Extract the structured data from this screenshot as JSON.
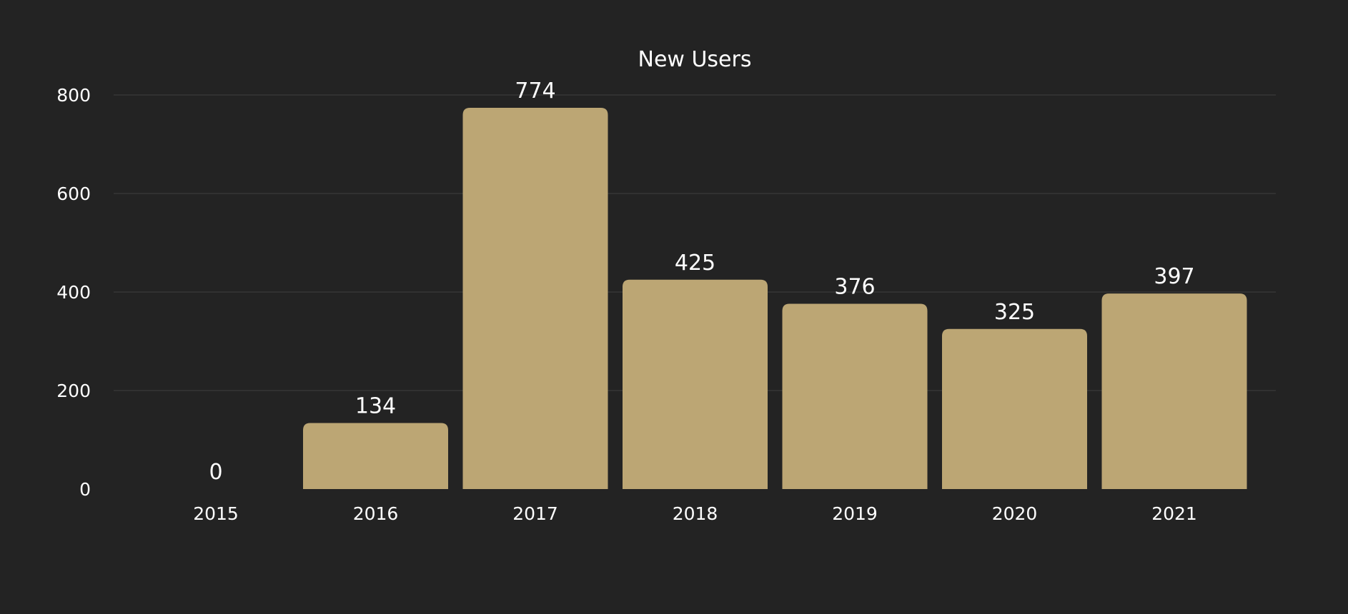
{
  "chart_data": {
    "type": "bar",
    "title": "New Users",
    "xlabel": "",
    "ylabel": "",
    "categories": [
      "2015",
      "2016",
      "2017",
      "2018",
      "2019",
      "2020",
      "2021"
    ],
    "values": [
      0,
      134,
      774,
      425,
      376,
      325,
      397
    ],
    "ylim": [
      0,
      800
    ],
    "yticks": [
      0,
      200,
      400,
      600,
      800
    ],
    "grid": true,
    "legend": "none",
    "data_labels": true,
    "colors": {
      "background": "#232323",
      "bar": "#bca674",
      "grid": "#363636",
      "text": "#ffffff"
    }
  }
}
